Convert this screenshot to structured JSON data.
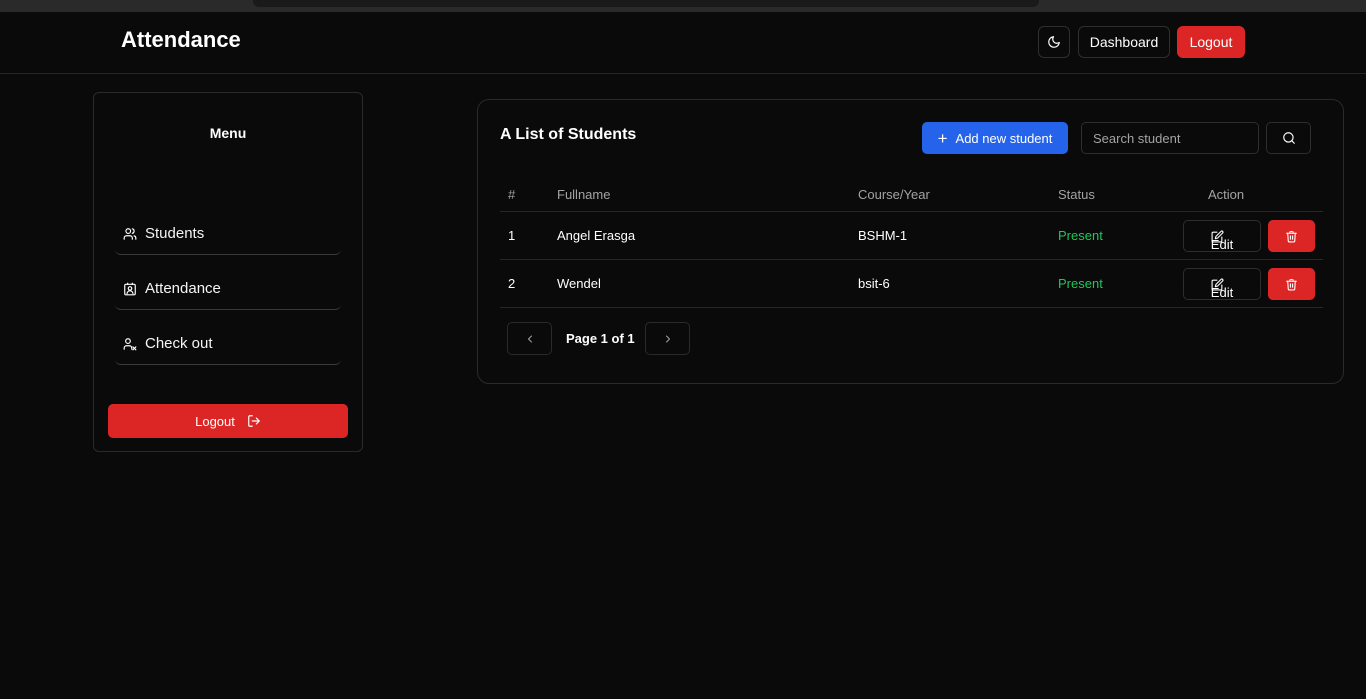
{
  "app": {
    "brand": "Attendance",
    "nav": {
      "theme_icon": "moon-icon",
      "dashboard_label": "Dashboard",
      "logout_label": "Logout"
    }
  },
  "sidebar": {
    "title": "Menu",
    "items": [
      {
        "label": "Students",
        "icon": "users-icon"
      },
      {
        "label": "Attendance",
        "icon": "contact-icon"
      },
      {
        "label": "Check out",
        "icon": "user-x-icon"
      }
    ],
    "logout_label": "Logout"
  },
  "students": {
    "title": "A List of Students",
    "add_label": "Add new student",
    "search_placeholder": "Search student",
    "columns": [
      "#",
      "Fullname",
      "Course/Year",
      "Status",
      "Action"
    ],
    "rows": [
      {
        "num": "1",
        "name": "Angel Erasga",
        "course": "BSHM-1",
        "status": "Present",
        "edit_label": "Edit"
      },
      {
        "num": "2",
        "name": "Wendel",
        "course": "bsit-6",
        "status": "Present",
        "edit_label": "Edit"
      }
    ],
    "pagination": {
      "label": "Page 1 of 1"
    }
  },
  "colors": {
    "background": "#0a0a0a",
    "danger": "#dc2626",
    "primary": "#2563eb",
    "success": "#22c55e"
  }
}
